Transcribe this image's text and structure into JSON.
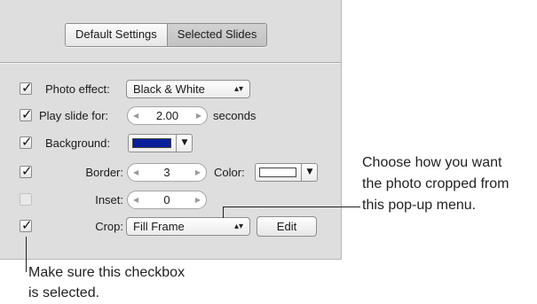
{
  "tabs": [
    {
      "label": "Default Settings",
      "active": false
    },
    {
      "label": "Selected Slides",
      "active": true
    }
  ],
  "rows": {
    "photo_effect": {
      "checked": true,
      "label": "Photo effect:",
      "value": "Black & White"
    },
    "play_slide": {
      "checked": true,
      "label": "Play slide for:",
      "value": "2.00",
      "unit": "seconds"
    },
    "background": {
      "checked": true,
      "label": "Background:",
      "color": "#0a1f9a"
    },
    "border": {
      "checked": true,
      "label": "Border:",
      "value": "3",
      "color_label": "Color:",
      "color": "#ffffff"
    },
    "inset": {
      "checked": false,
      "label": "Inset:",
      "value": "0"
    },
    "crop": {
      "checked": true,
      "label": "Crop:",
      "value": "Fill Frame",
      "edit_label": "Edit"
    }
  },
  "callouts": {
    "crop": [
      "Choose how you want",
      "the photo cropped from",
      "this pop-up menu."
    ],
    "checkbox": [
      "Make sure this checkbox",
      "is selected."
    ]
  },
  "icons": {
    "check": "checkmark-icon",
    "popup": "updown-arrows-icon",
    "stepper_left": "triangle-left-icon",
    "stepper_right": "triangle-right-icon",
    "dropdown": "triangle-down-icon"
  }
}
